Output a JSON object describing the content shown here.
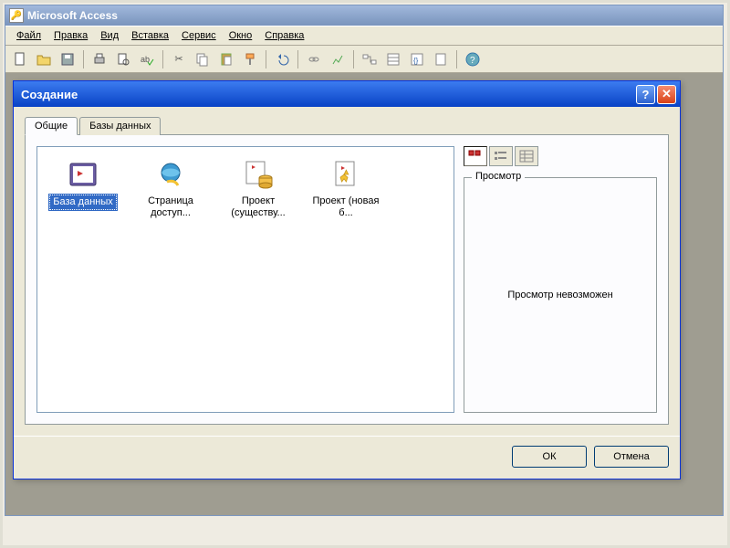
{
  "app": {
    "title": "Microsoft Access"
  },
  "menu": {
    "file": "Файл",
    "edit": "Правка",
    "view": "Вид",
    "insert": "Вставка",
    "tools": "Сервис",
    "window": "Окно",
    "help": "Справка"
  },
  "dialog": {
    "title": "Создание",
    "tabs": {
      "general": "Общие",
      "databases": "Базы данных"
    },
    "templates": [
      {
        "label": "База данных",
        "icon": "db-key",
        "selected": true
      },
      {
        "label": "Страница доступ...",
        "icon": "ie-globe",
        "selected": false
      },
      {
        "label": "Проект (существу...",
        "icon": "db-cylinder",
        "selected": false
      },
      {
        "label": "Проект (новая б...",
        "icon": "db-spark",
        "selected": false
      }
    ],
    "preview": {
      "legend": "Просмотр",
      "text": "Просмотр невозможен"
    },
    "buttons": {
      "ok": "ОК",
      "cancel": "Отмена"
    }
  }
}
